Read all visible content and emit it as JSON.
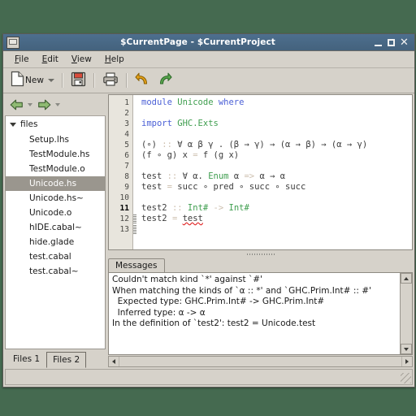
{
  "window": {
    "title": "$CurrentPage - $CurrentProject",
    "sysmenu_icon": "window-menu-icon",
    "minimize_icon": "minimize-icon",
    "maximize_icon": "maximize-icon",
    "close_icon": "close-icon"
  },
  "menubar": {
    "items": [
      {
        "mnemonic": "F",
        "rest": "ile"
      },
      {
        "mnemonic": "E",
        "rest": "dit"
      },
      {
        "mnemonic": "V",
        "rest": "iew"
      },
      {
        "mnemonic": "H",
        "rest": "elp"
      }
    ]
  },
  "toolbar": {
    "new_label": "New",
    "new_icon": "new-document-icon",
    "new_dropdown_icon": "chevron-down-icon",
    "save_icon": "save-floppy-icon",
    "print_icon": "print-icon",
    "undo_icon": "undo-arrow-icon",
    "redo_icon": "redo-arrow-icon"
  },
  "sidebar": {
    "nav": {
      "back_icon": "back-arrow-icon",
      "back_dropdown_icon": "chevron-down-icon",
      "forward_icon": "forward-arrow-icon",
      "forward_dropdown_icon": "chevron-down-icon"
    },
    "tree": {
      "root_label": "files",
      "root_expander_icon": "expander-open-icon",
      "items": [
        {
          "label": "Setup.lhs",
          "selected": false
        },
        {
          "label": "TestModule.hs",
          "selected": false
        },
        {
          "label": "TestModule.o",
          "selected": false
        },
        {
          "label": "Unicode.hs",
          "selected": true
        },
        {
          "label": "Unicode.hs~",
          "selected": false
        },
        {
          "label": "Unicode.o",
          "selected": false
        },
        {
          "label": "hIDE.cabal~",
          "selected": false
        },
        {
          "label": "hide.glade",
          "selected": false
        },
        {
          "label": "test.cabal",
          "selected": false
        },
        {
          "label": "test.cabal~",
          "selected": false
        }
      ]
    },
    "tabs": [
      {
        "label": "Files 1",
        "active": false
      },
      {
        "label": "Files 2",
        "active": true
      }
    ]
  },
  "editor": {
    "current_line": 11,
    "lines": [
      {
        "n": 1,
        "marker": false,
        "tokens": [
          {
            "t": "module ",
            "c": "kw"
          },
          {
            "t": "Unicode ",
            "c": "typ"
          },
          {
            "t": "where",
            "c": "kw"
          }
        ]
      },
      {
        "n": 2,
        "marker": false,
        "tokens": []
      },
      {
        "n": 3,
        "marker": false,
        "tokens": [
          {
            "t": "import ",
            "c": "kw"
          },
          {
            "t": "GHC.Exts",
            "c": "typ"
          }
        ]
      },
      {
        "n": 4,
        "marker": false,
        "tokens": []
      },
      {
        "n": 5,
        "marker": false,
        "tokens": [
          {
            "t": "(∘) ",
            "c": ""
          },
          {
            "t": "::",
            "c": "op"
          },
          {
            "t": " ∀ α β γ . (β → γ) → (α → β) → (α → γ)",
            "c": ""
          }
        ]
      },
      {
        "n": 6,
        "marker": false,
        "tokens": [
          {
            "t": "(f ∘ g) x ",
            "c": ""
          },
          {
            "t": "=",
            "c": "op"
          },
          {
            "t": " f (g x)",
            "c": ""
          }
        ]
      },
      {
        "n": 7,
        "marker": false,
        "tokens": []
      },
      {
        "n": 8,
        "marker": false,
        "tokens": [
          {
            "t": "test ",
            "c": ""
          },
          {
            "t": "::",
            "c": "op"
          },
          {
            "t": " ∀ α. ",
            "c": ""
          },
          {
            "t": "Enum",
            "c": "typ"
          },
          {
            "t": " α ",
            "c": ""
          },
          {
            "t": "=>",
            "c": "op"
          },
          {
            "t": " α → α",
            "c": ""
          }
        ]
      },
      {
        "n": 9,
        "marker": false,
        "tokens": [
          {
            "t": "test ",
            "c": ""
          },
          {
            "t": "=",
            "c": "op"
          },
          {
            "t": " succ ∘ pred ∘ succ ∘ succ",
            "c": ""
          }
        ]
      },
      {
        "n": 10,
        "marker": false,
        "tokens": []
      },
      {
        "n": 11,
        "marker": false,
        "tokens": [
          {
            "t": "test2 ",
            "c": ""
          },
          {
            "t": "::",
            "c": "op"
          },
          {
            "t": " ",
            "c": ""
          },
          {
            "t": "Int#",
            "c": "typ"
          },
          {
            "t": " -> ",
            "c": "op"
          },
          {
            "t": "Int#",
            "c": "typ"
          }
        ]
      },
      {
        "n": 12,
        "marker": true,
        "tokens": [
          {
            "t": "test2 ",
            "c": ""
          },
          {
            "t": "=",
            "c": "op"
          },
          {
            "t": " ",
            "c": ""
          },
          {
            "t": "test",
            "c": "err"
          }
        ]
      },
      {
        "n": 13,
        "marker": true,
        "tokens": []
      }
    ]
  },
  "splitter": {
    "grip_icon": "splitter-grip-icon"
  },
  "messages": {
    "tab_label": "Messages",
    "text": "Couldn't match kind `*' against `#'\nWhen matching the kinds of `α :: *' and `GHC.Prim.Int# :: #'\n  Expected type: GHC.Prim.Int# -> GHC.Prim.Int#\n  Inferred type: α -> α\nIn the definition of `test2': test2 = Unicode.test",
    "scroll_up_icon": "scroll-up-arrow-icon",
    "scroll_down_icon": "scroll-down-arrow-icon"
  },
  "hscroll": {
    "left_icon": "scroll-left-arrow-icon",
    "right_icon": "scroll-right-arrow-icon"
  },
  "statusbar": {
    "text": "",
    "resize_grip_icon": "resize-grip-icon"
  }
}
